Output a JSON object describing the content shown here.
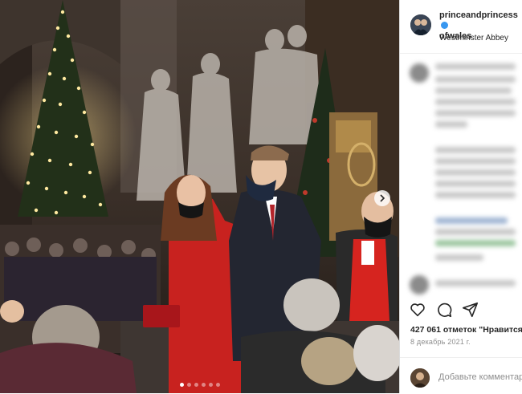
{
  "post": {
    "username": "princeandprincessofwales",
    "username_line1": "princeandprincess",
    "username_line2": "ofwales",
    "location": "Westminster Abbey",
    "likes_text": "427 061 отметок \"Нравится\"",
    "date_text": "8 декабрь 2021 г.",
    "comment_placeholder": "Добавьте комментарий..."
  },
  "carousel": {
    "slide_count": 6,
    "current_slide": 1
  },
  "icons": {
    "verified": "verified-badge-icon",
    "next": "chevron-right-icon",
    "like": "heart-icon",
    "comment": "speech-bubble-icon",
    "share": "paper-plane-icon"
  },
  "colors": {
    "verified": "#3897f0",
    "text": "#262626",
    "muted": "#8e8e8e",
    "border": "#dbdbdb"
  }
}
